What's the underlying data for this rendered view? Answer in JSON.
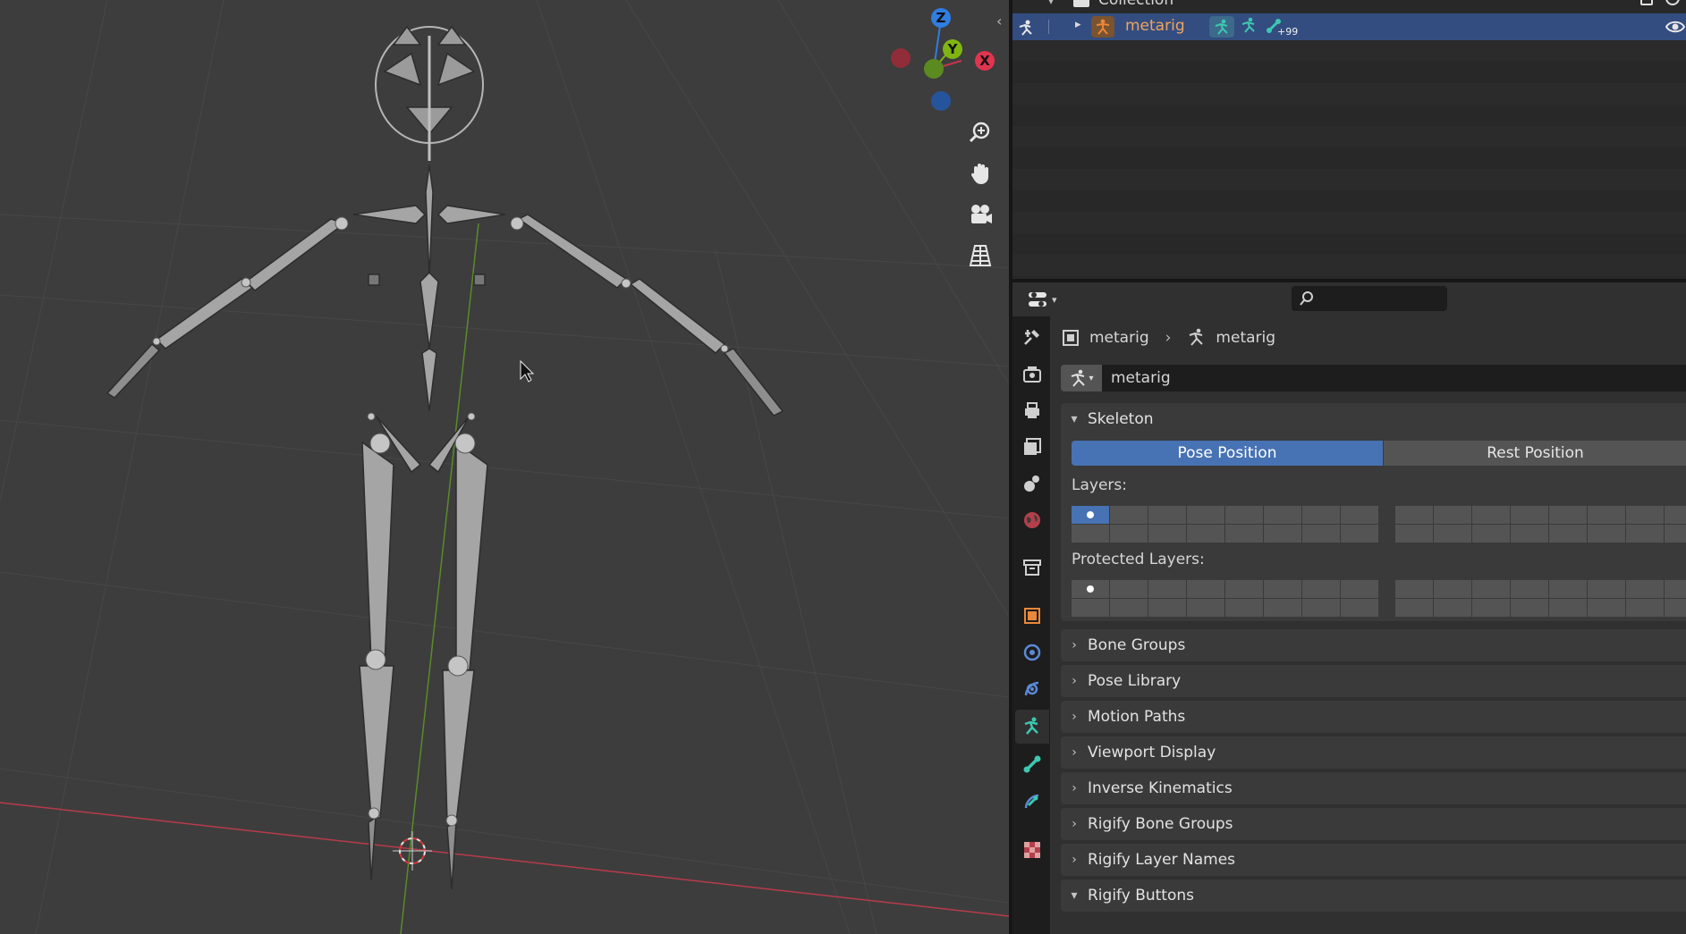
{
  "outliner": {
    "collection_label": "Collection",
    "object_name": "metarig",
    "child_count_badge": "+99"
  },
  "properties": {
    "search_placeholder": "",
    "breadcrumb": {
      "object": "metarig",
      "armature": "metarig"
    },
    "datablock_name": "metarig",
    "skeleton": {
      "title": "Skeleton",
      "pose_position": "Pose Position",
      "rest_position": "Rest Position",
      "layers_label": "Layers:",
      "protected_layers_label": "Protected Layers:"
    },
    "panels": [
      "Bone Groups",
      "Pose Library",
      "Motion Paths",
      "Viewport Display",
      "Inverse Kinematics",
      "Rigify Bone Groups",
      "Rigify Layer Names",
      "Rigify Buttons"
    ]
  },
  "viewport": {
    "gizmo": {
      "x_label": "X",
      "y_label": "Y",
      "z_label": "Z"
    }
  },
  "colors": {
    "selection_blue": "#4772b3",
    "outliner_highlight": "#334d80",
    "axis_x": "#e0344f",
    "axis_y": "#7fb512",
    "axis_z": "#2f7ee0",
    "object_orange": "#e9883a",
    "armature_teal": "#3dc8b0"
  },
  "icons": [
    "armature-icon",
    "restrict-view-icon",
    "wrench-icon",
    "render-icon",
    "output-icon",
    "view-layer-icon",
    "scene-icon",
    "world-icon",
    "collection-icon",
    "object-icon",
    "physics-icon",
    "constraints-icon",
    "object-data-icon",
    "bone-icon",
    "bone-constraint-icon",
    "texture-icon",
    "zoom-icon",
    "hand-icon",
    "camera-icon",
    "grid-icon"
  ]
}
